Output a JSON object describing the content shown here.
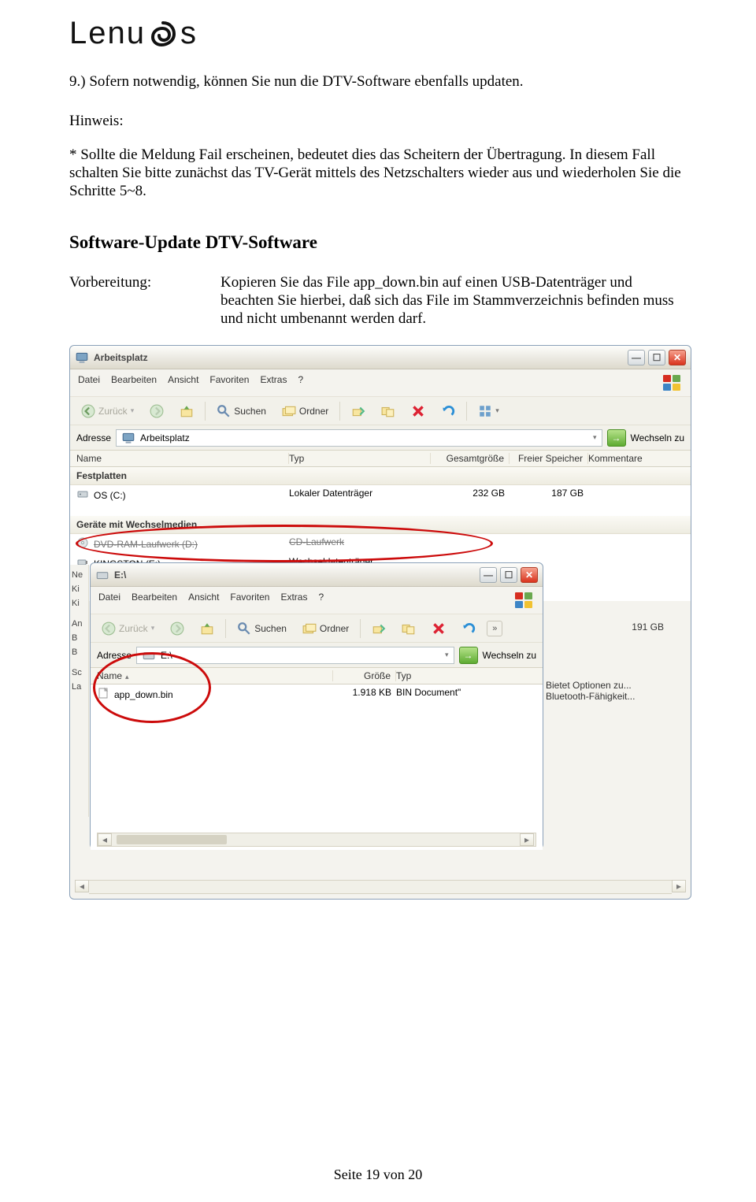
{
  "logo": {
    "text": "Lenu",
    "suffix": "s"
  },
  "doc": {
    "intro": "9.) Sofern notwendig, können Sie nun die DTV-Software ebenfalls updaten.",
    "hint_label": "Hinweis:",
    "hint_body": "* Sollte die Meldung Fail erscheinen, bedeutet dies das Scheitern der Übertragung. In diesem Fall schalten Sie bitte zunächst das TV-Gerät mittels des Netzschalters wieder aus und wiederholen Sie die Schritte 5~8.",
    "section_h": "Software-Update DTV-Software",
    "prep_label": "Vorbereitung:",
    "prep_body": "Kopieren Sie das File app_down.bin auf einen USB-Datenträger und beachten Sie hierbei, daß sich das File im Stammverzeichnis befinden muss und nicht umbenannt werden darf."
  },
  "win_main": {
    "title": "Arbeitsplatz",
    "menu": [
      "Datei",
      "Bearbeiten",
      "Ansicht",
      "Favoriten",
      "Extras",
      "?"
    ],
    "back": "Zurück",
    "search": "Suchen",
    "folders": "Ordner",
    "addr_label": "Adresse",
    "addr_value": "Arbeitsplatz",
    "go": "Wechseln zu",
    "cols": [
      "Name",
      "Typ",
      "Gesamtgröße",
      "Freier Speicher",
      "Kommentare"
    ],
    "group1": "Festplatten",
    "group2": "Geräte mit Wechselmedien",
    "rows": [
      {
        "name": "OS (C:)",
        "typ": "Lokaler Datenträger",
        "g": "232 GB",
        "f": "187 GB"
      },
      {
        "name": "DVD-RAM-Laufwerk (D:)",
        "typ": "CD-Laufwerk",
        "g": "",
        "f": ""
      },
      {
        "name": "KINGSTON (E:)",
        "typ": "Wechseldatenträger",
        "g": "",
        "f": ""
      }
    ],
    "right_frag_size": "191 GB",
    "right_frag_k1": "Bietet Optionen zu...",
    "right_frag_k2": "Bluetooth-Fähigkeit...",
    "left_frags": [
      "Ne",
      "Ki",
      "Ki",
      "An",
      "B",
      "B",
      "Sc",
      "La"
    ]
  },
  "win_sub": {
    "title": "E:\\",
    "menu": [
      "Datei",
      "Bearbeiten",
      "Ansicht",
      "Favoriten",
      "Extras",
      "?"
    ],
    "back": "Zurück",
    "search": "Suchen",
    "folders": "Ordner",
    "addr_label": "Adresse",
    "addr_value": "E:\\",
    "go": "Wechseln zu",
    "cols": [
      "Name",
      "Größe",
      "Typ"
    ],
    "row": {
      "name": "app_down.bin",
      "size": "1.918 KB",
      "typ": "BIN Document\""
    }
  },
  "footer": "Seite 19 von 20"
}
